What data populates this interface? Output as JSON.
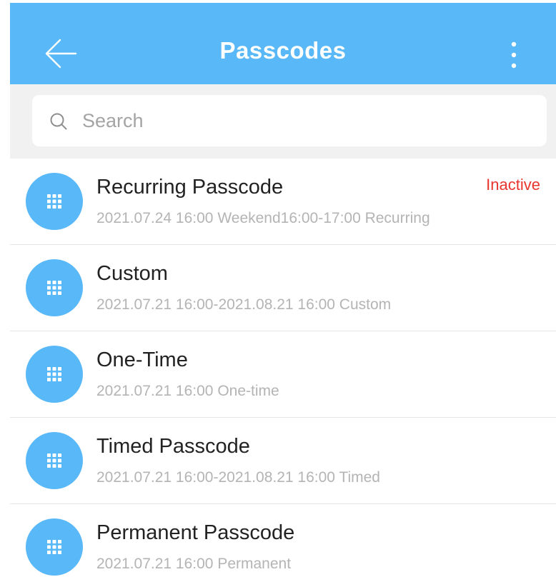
{
  "header": {
    "title": "Passcodes",
    "background_color": "#59b8f7",
    "back_icon": "arrow-left-icon",
    "more_icon": "more-vertical-icon"
  },
  "search": {
    "placeholder": "Search",
    "value": "",
    "icon": "search-icon"
  },
  "passcodes": [
    {
      "title": "Recurring Passcode",
      "subtitle": "2021.07.24 16:00   Weekend16:00-17:00 Recurring",
      "status": "Inactive",
      "status_color": "#e8352e",
      "icon": "keypad-icon"
    },
    {
      "title": "Custom",
      "subtitle": "2021.07.21 16:00-2021.08.21 16:00   Custom",
      "status": "",
      "icon": "keypad-icon"
    },
    {
      "title": "One-Time",
      "subtitle": "2021.07.21 16:00   One-time",
      "status": "",
      "icon": "keypad-icon"
    },
    {
      "title": "Timed Passcode",
      "subtitle": "2021.07.21 16:00-2021.08.21 16:00   Timed",
      "status": "",
      "icon": "keypad-icon"
    },
    {
      "title": "Permanent Passcode",
      "subtitle": "2021.07.21 16:00   Permanent",
      "status": "",
      "icon": "keypad-icon"
    }
  ]
}
